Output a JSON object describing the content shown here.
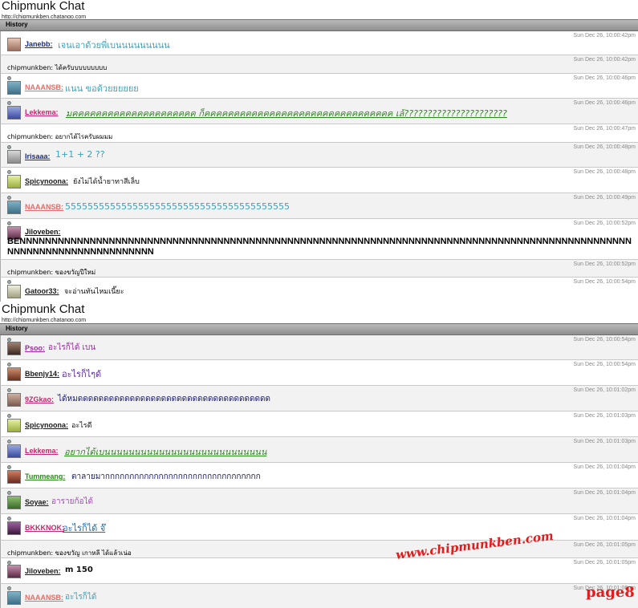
{
  "colors": {
    "header_bar": "#9e9e9e",
    "row_alt": "#f2f2f2",
    "timestamp": "#888888",
    "watermark": "#e21b1b"
  },
  "panel1": {
    "title": "Chipmunk Chat",
    "url": "http://chipmunkben.chatango.com",
    "history_label": "History",
    "messages": [
      {
        "name": "Janebb:",
        "text": "เจนเอาด้วยพี่เบนนนนนนนนน",
        "time": "Sun Dec 26, 10:00:42pm"
      },
      {
        "name": "",
        "text": "chipmunkben: ได้ครับบบบบบบบบ",
        "time": "Sun Dec 26, 10:00:42pm"
      },
      {
        "name": "NAAANSB:",
        "text": "แนน ขอด้วยยยยยย",
        "time": "Sun Dec 26, 10:00:46pm"
      },
      {
        "name": "Lekkema:",
        "text": "มคคคคคคคคคคคคคคคคคคคคค ก็คคคคคคคคคคคคคคคคคคคคคคคคคคคคคคคค เล้??????????????????????",
        "time": "Sun Dec 26, 10:00:46pm"
      },
      {
        "name": "",
        "text": "chipmunkben: อยากได้ไรครับผมมม",
        "time": "Sun Dec 26, 10:00:47pm"
      },
      {
        "name": "Irisaaa:",
        "text": "1+1 + 2  ??",
        "time": "Sun Dec 26, 10:00:48pm"
      },
      {
        "name": "Spicynoona:",
        "text": "ยังไม่ได้น้ำยาทาสีเล็บ",
        "time": "Sun Dec 26, 10:00:48pm"
      },
      {
        "name": "NAAANSB:",
        "text": "5555555555555555555555555555555555555555",
        "time": "Sun Dec 26, 10:00:49pm"
      },
      {
        "name": "Jiloveben:",
        "text": "BENNNNNNNNNNNNNNNNNNNNNNNNNNNNNNNNNNNNNNNNNNNNNNNNNNNNNNNNNNNNNNNNNNNNNNNNNNNNNNNNNNNNNNNNNNNNNNNNNNNNNNNNNNNNNNNNNNNNNNN",
        "time": "Sun Dec 26, 10:00:52pm"
      },
      {
        "name": "",
        "text": "chipmunkben: ของขวัญปีใหม่",
        "time": "Sun Dec 26, 10:00:52pm"
      },
      {
        "name": "Gatoor33:",
        "text": "จะอ่านทันไหมเนี๊ยะ",
        "time": "Sun Dec 26, 10:00:54pm"
      }
    ]
  },
  "panel2": {
    "title": "Chipmunk Chat",
    "url": "http://chipmunkben.chatango.com",
    "history_label": "History",
    "messages": [
      {
        "name": "Psoo:",
        "text": "อะไรก็ได้ เบน",
        "time": "Sun Dec 26, 10:00:54pm"
      },
      {
        "name": "Bbenjy14:",
        "text": "อะไรก็ไๆด้",
        "time": "Sun Dec 26, 10:00:54pm"
      },
      {
        "name": "9ZGkao:",
        "text": "ได้หมดดดดดดดดดดดดดดดดดดดดดดดดดดดดดดดดดดดดด",
        "time": "Sun Dec 26, 10:01:02pm"
      },
      {
        "name": "Spicynoona:",
        "text": "อะไรดี",
        "time": "Sun Dec 26, 10:01:03pm"
      },
      {
        "name": "Lekkema:",
        "text": "อยากได้เบนนนนนนนนนนนนนนนนนนนนนนนนนนน",
        "time": "Sun Dec 26, 10:01:03pm"
      },
      {
        "name": "Tummeang:",
        "text": "ตาลายมากกกกกกกกกกกกกกกกกกกกกกกกกกกกกกกก",
        "time": "Sun Dec 26, 10:01:04pm"
      },
      {
        "name": "Soyae:",
        "text": "อารายก้อได้",
        "time": "Sun Dec 26, 10:01:04pm"
      },
      {
        "name": "BKKKNOK:",
        "text": "อะไรก็ได้ จ๊",
        "time": "Sun Dec 26, 10:01:04pm"
      },
      {
        "name": "",
        "text": "chipmunkben: ของขวัญ เกาหลี ได้แล้วเน่อ",
        "time": "Sun Dec 26, 10:01:05pm"
      },
      {
        "name": "Jiloveben:",
        "text": "m 150",
        "time": "Sun Dec 26, 10:01:05pm"
      },
      {
        "name": "NAAANSB:",
        "text": "อะไรก็ได้",
        "time": "Sun Dec 26, 10:01:06pm"
      }
    ]
  },
  "watermark": {
    "url": "www.chipmunkben.com",
    "page": "page8"
  }
}
